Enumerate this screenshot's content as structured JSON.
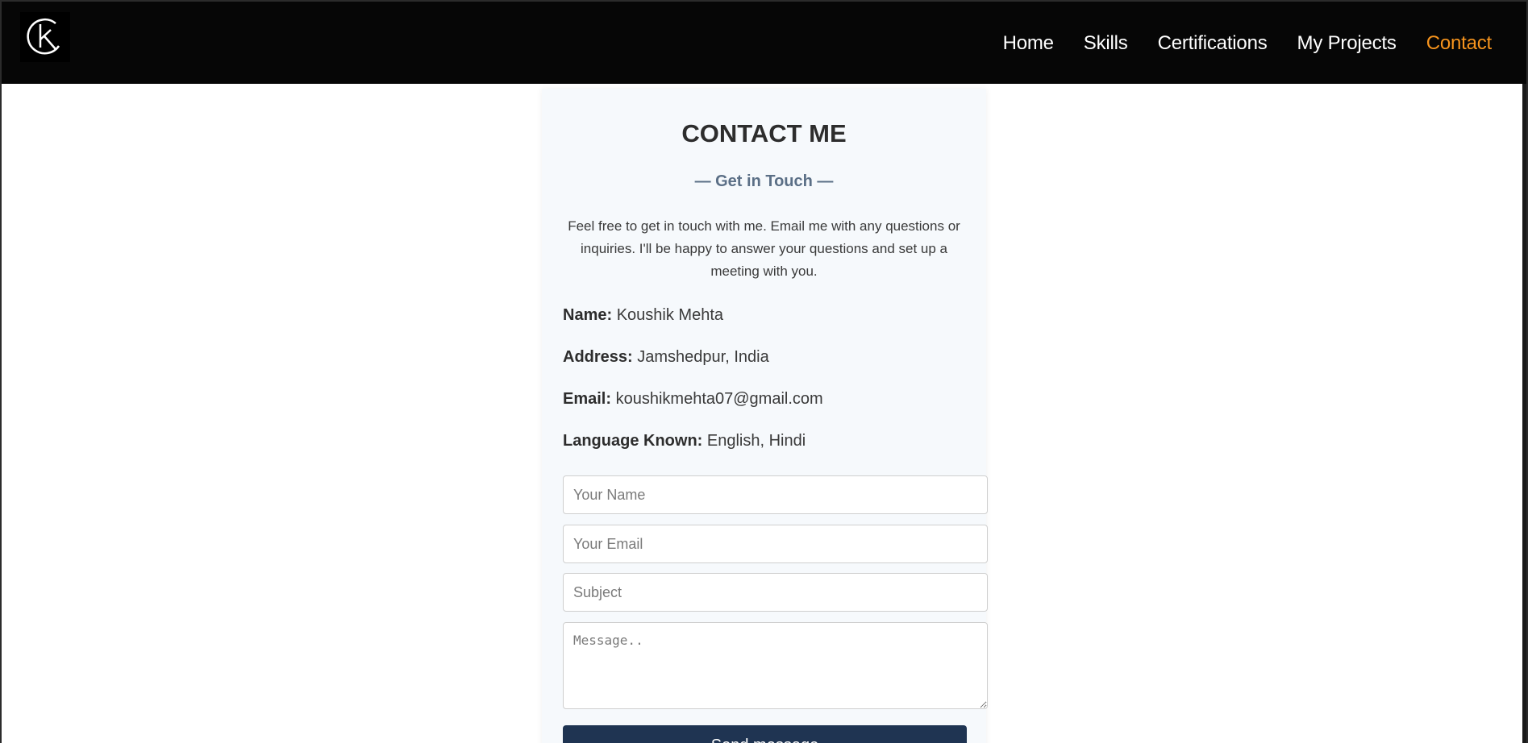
{
  "nav": {
    "logo_icon": "k-monogram-logo",
    "links": [
      {
        "label": "Home"
      },
      {
        "label": "Skills"
      },
      {
        "label": "Certifications"
      },
      {
        "label": "My Projects"
      },
      {
        "label": "Contact"
      }
    ],
    "active_color": "#f7941d"
  },
  "contact": {
    "title": "CONTACT ME",
    "subtitle": "— Get in Touch —",
    "intro": "Feel free to get in touch with me. Email me with any questions or inquiries. I'll be happy to answer your questions and set up a meeting with you.",
    "details": [
      {
        "label": "Name:",
        "value": "Koushik Mehta"
      },
      {
        "label": "Address:",
        "value": "Jamshedpur, India"
      },
      {
        "label": "Email:",
        "value": "koushikmehta07@gmail.com"
      },
      {
        "label": "Language Known:",
        "value": "English, Hindi"
      }
    ]
  },
  "form": {
    "name_placeholder": "Your Name",
    "email_placeholder": "Your Email",
    "subject_placeholder": "Subject",
    "message_placeholder": "Message..",
    "send_label": "Send message",
    "button_color": "#1f3452"
  }
}
